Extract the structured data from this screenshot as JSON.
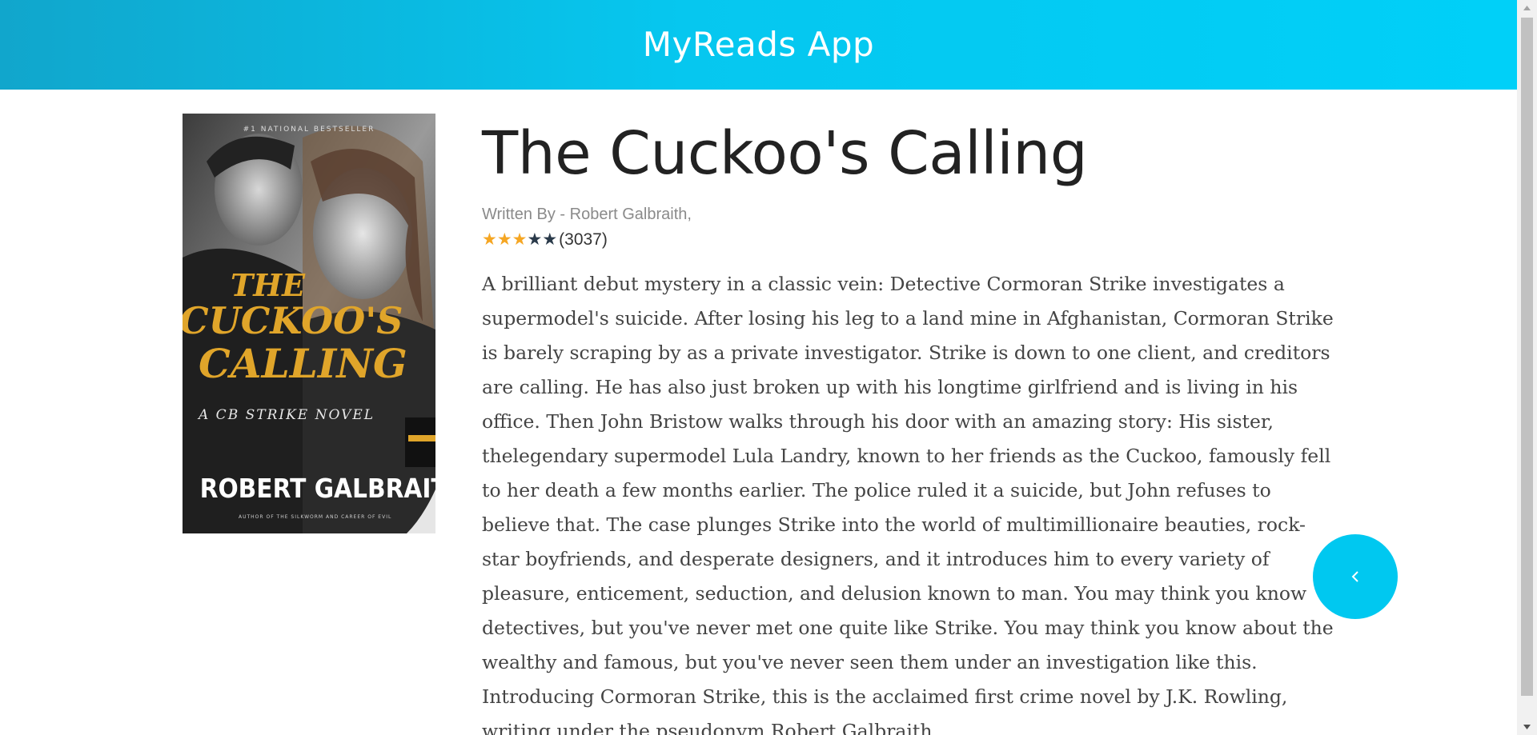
{
  "header": {
    "title": "MyReads App",
    "color": "#06c7ef"
  },
  "book": {
    "title": "The Cuckoo's Calling",
    "author_line": "Written By - Robert Galbraith,",
    "rating_stars": 3,
    "rating_max": 5,
    "rating_count": "(3037)",
    "description": "A brilliant debut mystery in a classic vein: Detective Cormoran Strike investigates a supermodel's suicide. After losing his leg to a land mine in Afghanistan, Cormoran Strike is barely scraping by as a private investigator. Strike is down to one client, and creditors are calling. He has also just broken up with his longtime girlfriend and is living in his office. Then John Bristow walks through his door with an amazing story: His sister, thelegendary supermodel Lula Landry, known to her friends as the Cuckoo, famously fell to her death a few months earlier. The police ruled it a suicide, but John refuses to believe that. The case plunges Strike into the world of multimillionaire beauties, rock-star boyfriends, and desperate designers, and it introduces him to every variety of pleasure, enticement, seduction, and delusion known to man. You may think you know detectives, but you've never met one quite like Strike. You may think you know about the wealthy and famous, but you've never seen them under an investigation like this. Introducing Cormoran Strike, this is the acclaimed first crime novel by J.K. Rowling, writing under the pseudonym Robert Galbraith."
  },
  "cover": {
    "top_banner": "#1 NATIONAL BESTSELLER",
    "title_line1": "THE",
    "title_line2": "CUCKOO'S",
    "title_line3": "CALLING",
    "subtitle": "A CB STRIKE NOVEL",
    "author": "ROBERT GALBRAITH",
    "bottom_line": "AUTHOR OF THE SILKWORM AND CAREER OF EVIL"
  },
  "back_button": {
    "icon": "chevron-left-icon",
    "color": "#00c8f0"
  },
  "colors": {
    "star_on": "#f5a623",
    "star_off": "#2a3a4a",
    "cover_title": "#e0a52a"
  }
}
